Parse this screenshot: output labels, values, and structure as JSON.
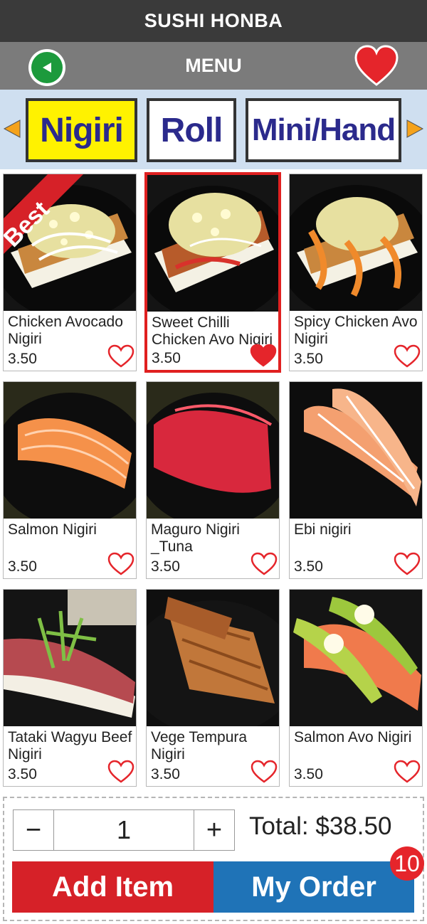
{
  "app": {
    "title": "SUSHI HONBA"
  },
  "header": {
    "menu_label": "MENU"
  },
  "tabs": [
    {
      "label": "Nigiri",
      "active": true
    },
    {
      "label": "Roll",
      "active": false
    },
    {
      "label": "Mini/Hand",
      "active": false
    }
  ],
  "items": [
    {
      "name": "Chicken Avocado Nigiri",
      "price": "3.50",
      "favorite": false,
      "badge": "Best",
      "selected": false
    },
    {
      "name": "Sweet Chilli Chicken Avo Nigiri",
      "price": "3.50",
      "favorite": true,
      "selected": true
    },
    {
      "name": "Spicy Chicken Avo Nigiri",
      "price": "3.50",
      "favorite": false,
      "selected": false
    },
    {
      "name": "Salmon Nigiri",
      "price": "3.50",
      "favorite": false,
      "selected": false
    },
    {
      "name": "Maguro Nigiri _Tuna",
      "price": "3.50",
      "favorite": false,
      "selected": false
    },
    {
      "name": "Ebi nigiri",
      "price": "3.50",
      "favorite": false,
      "selected": false
    },
    {
      "name": "Tataki Wagyu Beef Nigiri",
      "price": "3.50",
      "favorite": false,
      "selected": false
    },
    {
      "name": "Vege Tempura Nigiri",
      "price": "3.50",
      "favorite": false,
      "selected": false
    },
    {
      "name": "Salmon Avo Nigiri",
      "price": "3.50",
      "favorite": false,
      "selected": false
    }
  ],
  "order": {
    "minus": "−",
    "quantity": "1",
    "plus": "+",
    "total_label": "Total: $38.50",
    "add_label": "Add Item",
    "my_order_label": "My Order",
    "order_count": "10"
  },
  "colors": {
    "titlebar": "#3a3a3a",
    "menubar": "#7b7b7b",
    "active_tab": "#fff200",
    "tab_text": "#2b2a8c",
    "heart": "#e5252b",
    "add": "#d62128",
    "order": "#1f73b7",
    "back": "#1c9a3c"
  },
  "icons": {
    "back": "back-arrow-icon",
    "favorites": "heart-icon",
    "scroll_left": "triangle-left-icon",
    "scroll_right": "triangle-right-icon"
  }
}
